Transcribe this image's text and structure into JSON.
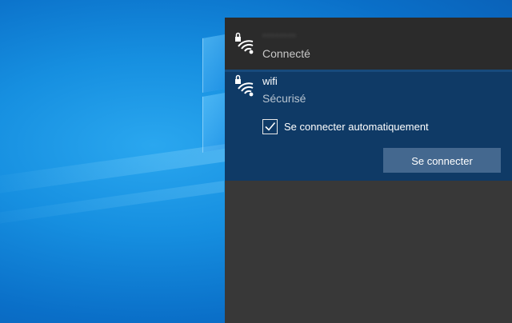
{
  "networks": [
    {
      "name": "········",
      "status": "Connecté",
      "icon": "wifi-secured-icon"
    },
    {
      "name": "wifi",
      "status": "Sécurisé",
      "icon": "wifi-secured-icon",
      "auto_connect_label": "Se connecter automatiquement",
      "auto_connect_checked": true,
      "connect_button": "Se connecter"
    }
  ],
  "colors": {
    "flyout_bg": "#383838",
    "connected_row_bg": "#2b2b2b",
    "selected_row_bg": "#0f3a66",
    "button_bg": "#44688f",
    "desktop_blue": "#168fe0"
  }
}
